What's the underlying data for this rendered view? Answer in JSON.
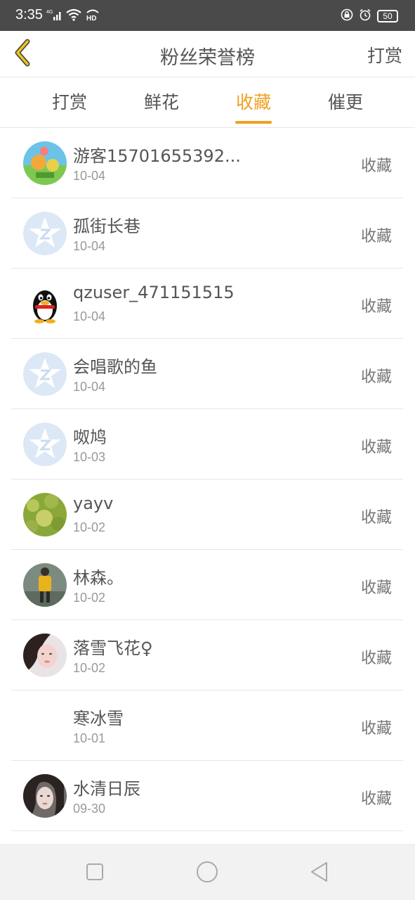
{
  "status_bar": {
    "time": "3:35",
    "network": "4G",
    "hd": "HD",
    "battery": "50",
    "icons": [
      "signal-icon",
      "wifi-icon",
      "hd-icon",
      "lock-rotation-icon",
      "alarm-icon",
      "battery-icon"
    ]
  },
  "header": {
    "title": "粉丝荣誉榜",
    "action_label": "打赏",
    "back_icon": "chevron-left-icon",
    "accent_color": "#f0a020"
  },
  "tabs": [
    {
      "label": "打赏",
      "active": false
    },
    {
      "label": "鲜花",
      "active": false
    },
    {
      "label": "收藏",
      "active": true
    },
    {
      "label": "催更",
      "active": false
    }
  ],
  "fans": [
    {
      "name": "游客15701655392...",
      "date": "10-04",
      "action": "收藏",
      "avatar": "game-avatar"
    },
    {
      "name": "孤街长巷",
      "date": "10-04",
      "action": "收藏",
      "avatar": "default-star-avatar"
    },
    {
      "name": "qzuser_471151515",
      "date": "10-04",
      "action": "收藏",
      "avatar": "qq-penguin-avatar"
    },
    {
      "name": "会唱歌的鱼",
      "date": "10-04",
      "action": "收藏",
      "avatar": "default-star-avatar"
    },
    {
      "name": "呶鸠",
      "date": "10-03",
      "action": "收藏",
      "avatar": "default-star-avatar"
    },
    {
      "name": "yayv",
      "date": "10-02",
      "action": "收藏",
      "avatar": "photo-avatar"
    },
    {
      "name": "林森。",
      "date": "10-02",
      "action": "收藏",
      "avatar": "photo-avatar"
    },
    {
      "name": "落雪飞花♀",
      "date": "10-02",
      "action": "收藏",
      "avatar": "photo-avatar"
    },
    {
      "name": "寒冰雪",
      "date": "10-01",
      "action": "收藏",
      "avatar": "none"
    },
    {
      "name": "水清日辰",
      "date": "09-30",
      "action": "收藏",
      "avatar": "photo-avatar"
    }
  ],
  "nav": {
    "icons": [
      "recents-square-icon",
      "home-circle-icon",
      "back-triangle-icon"
    ]
  }
}
